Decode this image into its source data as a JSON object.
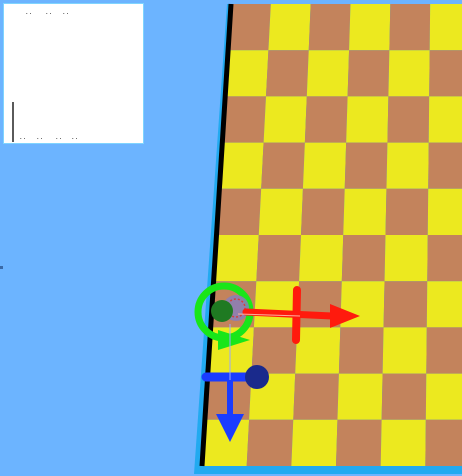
{
  "scene": {
    "background_color": "#6cb4ff",
    "board": {
      "rows": 10,
      "cols": 6,
      "color_a": "#c3835c",
      "color_b": "#ece91f",
      "edge_color": "#000000",
      "rim_color": "#22aaf0"
    },
    "gizmo": {
      "x_axis_color": "#ff1a0d",
      "y_axis_color": "#1a3cff",
      "z_axis_color": "#19e619",
      "rotate_ring_color": "#19e619",
      "center_color": "#1f7a22"
    }
  },
  "inset": {
    "top_marks": [
      "..",
      "..",
      ".."
    ],
    "bottom_marks": [
      "..",
      "..",
      "..",
      ".."
    ],
    "border_color": "#7fd4ff"
  }
}
